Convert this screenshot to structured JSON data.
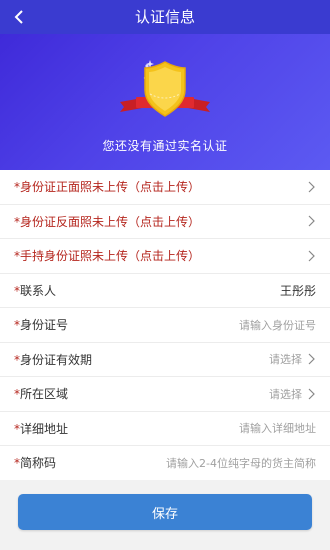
{
  "header": {
    "title": "认证信息",
    "back_icon": "chevron-left-icon"
  },
  "hero": {
    "message": "您还没有通过实名认证",
    "badge_icon": "shield-badge-icon"
  },
  "form": {
    "rows": [
      {
        "label": "*身份证正面照未上传（点击上传）",
        "value": "",
        "placeholder": "",
        "chevron": true
      },
      {
        "label": "*身份证反面照未上传（点击上传）",
        "value": "",
        "placeholder": "",
        "chevron": true
      },
      {
        "label": "*手持身份证照未上传（点击上传）",
        "value": "",
        "placeholder": "",
        "chevron": true
      },
      {
        "label": "联系人",
        "value": "王彤彤",
        "placeholder": "",
        "chevron": false
      },
      {
        "label": "身份证号",
        "value": "",
        "placeholder": "请输入身份证号",
        "chevron": false
      },
      {
        "label": "身份证有效期",
        "value": "",
        "placeholder": "请选择",
        "chevron": true
      },
      {
        "label": "所在区域",
        "value": "",
        "placeholder": "请选择",
        "chevron": true
      },
      {
        "label": "详细地址",
        "value": "",
        "placeholder": "请输入详细地址",
        "chevron": false
      },
      {
        "label": "简称码",
        "value": "",
        "placeholder": "请输入2-4位纯字母的货主简称",
        "chevron": false
      }
    ],
    "required_mark": "*"
  },
  "footer": {
    "save_label": "保存"
  },
  "colors": {
    "navbar": "#3a3bd0",
    "hero_start": "#3f2ad9",
    "hero_end": "#5c5af2",
    "required_red": "#b5261e",
    "save_button": "#3b82d4",
    "badge_gold": "#f4c21b",
    "ribbon_red": "#d9262b"
  }
}
